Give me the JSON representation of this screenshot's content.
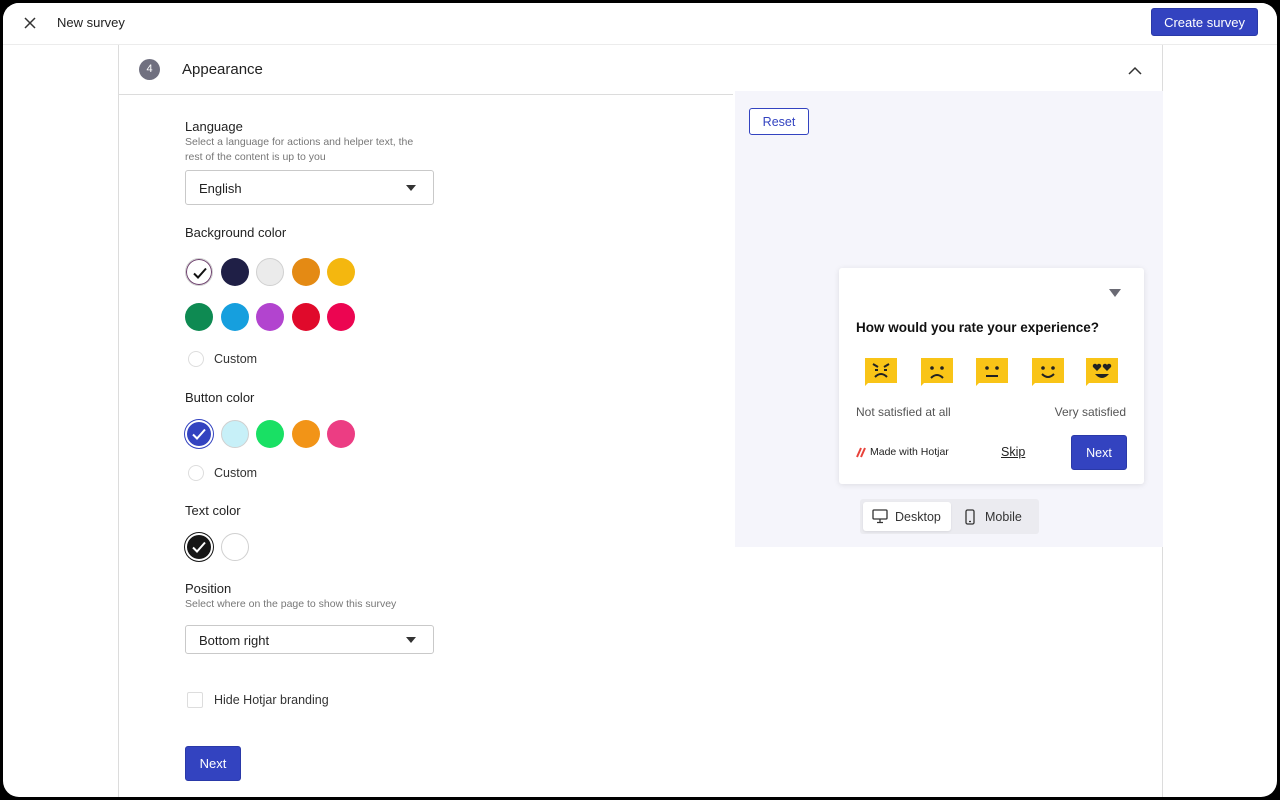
{
  "header": {
    "title": "New survey",
    "create_label": "Create survey"
  },
  "section": {
    "step": "4",
    "title": "Appearance"
  },
  "language": {
    "label": "Language",
    "helper_line1": "Select a language for actions and helper text, the",
    "helper_line2": "rest of the content is up to you",
    "value": "English"
  },
  "background_color": {
    "label": "Background color",
    "swatches": [
      "#ffffff",
      "#1f1f46",
      "#ebebeb",
      "#e48a14",
      "#f4b70f",
      "#0e8a52",
      "#169fde",
      "#b244cf",
      "#e00a2b",
      "#ec0551"
    ],
    "selected_index": 0,
    "custom_label": "Custom"
  },
  "button_color": {
    "label": "Button color",
    "swatches": [
      "#3343c0",
      "#c7f0f8",
      "#19e064",
      "#f29417",
      "#ec3d83"
    ],
    "selected_index": 0,
    "custom_label": "Custom"
  },
  "text_color": {
    "label": "Text color",
    "swatches": [
      "#161616",
      "#ffffff"
    ],
    "selected_index": 0
  },
  "position": {
    "label": "Position",
    "helper": "Select where on the page to show this survey",
    "value": "Bottom right"
  },
  "branding": {
    "hide_label": "Hide Hotjar branding",
    "checked": false
  },
  "next_label": "Next",
  "preview": {
    "reset_label": "Reset",
    "question": "How would you rate your experience?",
    "scale_low": "Not satisfied at all",
    "scale_high": "Very satisfied",
    "brand_text": "Made with Hotjar",
    "skip_label": "Skip",
    "next_label": "Next",
    "emoji_color": "#f9c417",
    "emojis": [
      "angry-face-icon",
      "sad-face-icon",
      "neutral-face-icon",
      "smile-face-icon",
      "heart-eyes-face-icon"
    ],
    "devices": {
      "desktop_label": "Desktop",
      "mobile_label": "Mobile",
      "active": "Desktop"
    }
  }
}
